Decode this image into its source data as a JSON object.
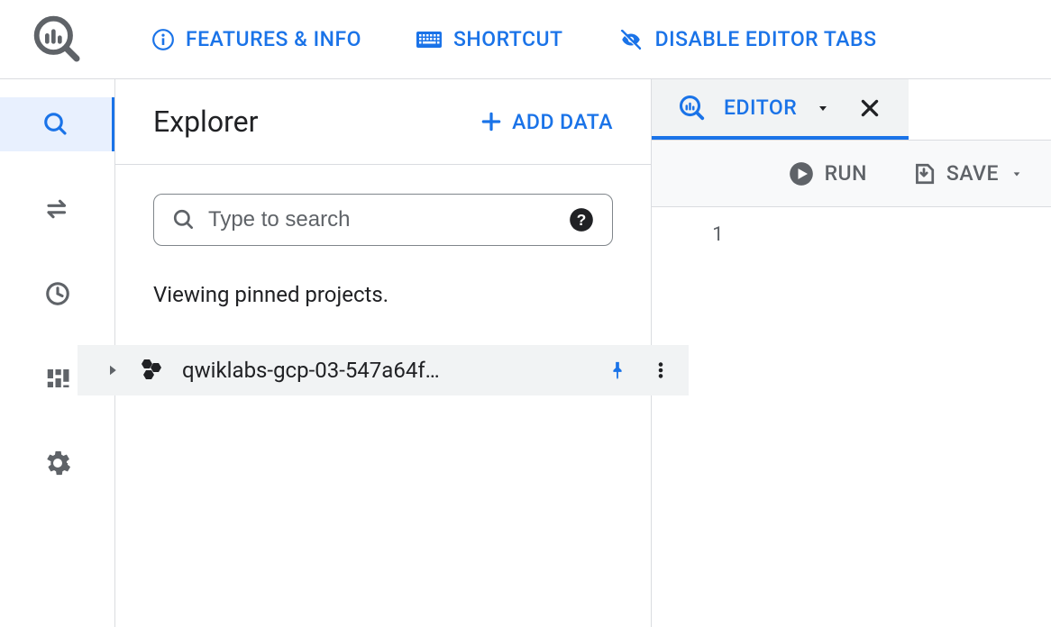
{
  "top_actions": {
    "features": "FEATURES & INFO",
    "shortcut": "SHORTCUT",
    "disable_tabs": "DISABLE EDITOR TABS"
  },
  "explorer": {
    "title": "Explorer",
    "add_data": "ADD DATA",
    "search_placeholder": "Type to search",
    "pinned_message": "Viewing pinned projects.",
    "project_name": "qwiklabs-gcp-03-547a64f…"
  },
  "editor": {
    "tab_label": "EDITOR",
    "run_label": "RUN",
    "save_label": "SAVE",
    "line_number": "1"
  }
}
